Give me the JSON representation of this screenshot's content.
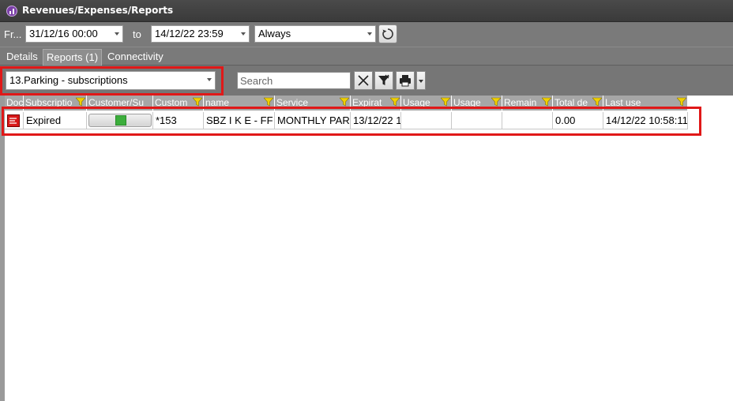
{
  "window": {
    "title": "Revenues/Expenses/Reports",
    "icon": "chart-icon"
  },
  "date_filter": {
    "from_label": "Fr...",
    "from_value": "31/12/16 00:00",
    "to_label": "to",
    "to_value": "14/12/22 23:59",
    "period_value": "Always"
  },
  "tabs": [
    {
      "label": "Details",
      "active": false
    },
    {
      "label": "Reports (1)",
      "active": true
    },
    {
      "label": "Connectivity",
      "active": false
    }
  ],
  "toolbar": {
    "report_select": "13.Parking - subscriptions",
    "search_placeholder": "Search"
  },
  "table": {
    "columns": [
      "Doc",
      "Subscriptio",
      "Customer/Su",
      "Custom",
      "name",
      "Service",
      "Expirat",
      "Usage",
      "Usage",
      "Remain",
      "Total de",
      "Last use"
    ],
    "rows": [
      {
        "doc_icon": "document-icon",
        "subscription": "Expired",
        "customer_icon": "user-icon",
        "customer_code": "*153",
        "name": "SBZ I K E - FF",
        "service": "MONTHLY PAR",
        "expiration": "13/12/22 1",
        "usage1": "",
        "usage2": "",
        "remaining": "",
        "total": "0.00",
        "last_use": "14/12/22 10:58:11"
      }
    ]
  },
  "colors": {
    "highlight": "#e01818",
    "title_bar": "#3f3f3f",
    "panel": "#7a7a7a",
    "grid_header": "#a6a6a6",
    "filter_icon": "#f0d000"
  }
}
